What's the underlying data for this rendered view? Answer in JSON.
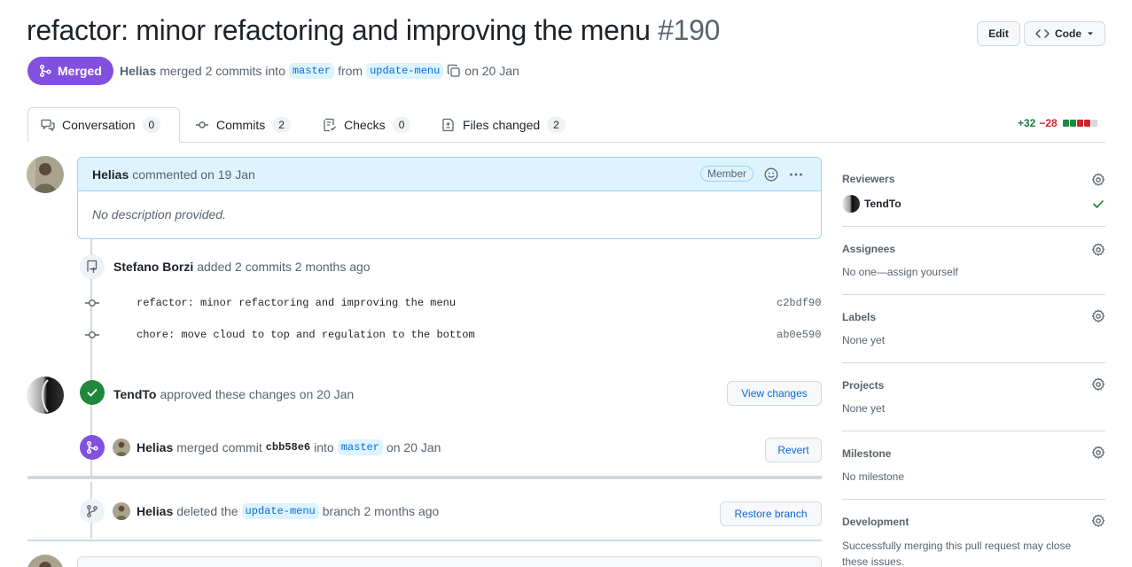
{
  "pr": {
    "title": "refactor: minor refactoring and improving the menu",
    "number": "#190",
    "edit_label": "Edit",
    "code_label": "Code",
    "status": "Merged",
    "author": "Helias",
    "merged_text": "merged 2 commits into",
    "base_branch": "master",
    "from_text": "from",
    "head_branch": "update-menu",
    "date_text": "on 20 Jan"
  },
  "tabs": [
    {
      "label": "Conversation",
      "count": "0"
    },
    {
      "label": "Commits",
      "count": "2"
    },
    {
      "label": "Checks",
      "count": "0"
    },
    {
      "label": "Files changed",
      "count": "2"
    }
  ],
  "diffstat": {
    "additions": "+32",
    "deletions": "−28"
  },
  "comment": {
    "author": "Helias",
    "action": "commented on 19 Jan",
    "role": "Member",
    "body": "No description provided."
  },
  "commits_event": {
    "author": "Stefano Borzi",
    "text": "added 2 commits 2 months ago",
    "commits": [
      {
        "message": "refactor: minor refactoring and improving the menu",
        "sha": "c2bdf90"
      },
      {
        "message": "chore: move cloud to top and regulation to the bottom",
        "sha": "ab0e590"
      }
    ]
  },
  "approval": {
    "author": "TendTo",
    "text": "approved these changes on 20 Jan",
    "button": "View changes"
  },
  "merge_event": {
    "author": "Helias",
    "text": "merged commit",
    "sha": "cbb58e6",
    "into": "into",
    "branch": "master",
    "date": "on 20 Jan",
    "button": "Revert"
  },
  "delete_event": {
    "author": "Helias",
    "text": "deleted the",
    "branch": "update-menu",
    "suffix": "branch 2 months ago",
    "button": "Restore branch"
  },
  "sidebar": {
    "reviewers": {
      "title": "Reviewers",
      "name": "TendTo"
    },
    "assignees": {
      "title": "Assignees",
      "value": "No one—assign yourself"
    },
    "labels": {
      "title": "Labels",
      "value": "None yet"
    },
    "projects": {
      "title": "Projects",
      "value": "None yet"
    },
    "milestone": {
      "title": "Milestone",
      "value": "No milestone"
    },
    "development": {
      "title": "Development",
      "value": "Successfully merging this pull request may close these issues."
    }
  },
  "colors": {
    "merged": "#8250df",
    "approved": "#1f883d",
    "link": "#0969da"
  }
}
